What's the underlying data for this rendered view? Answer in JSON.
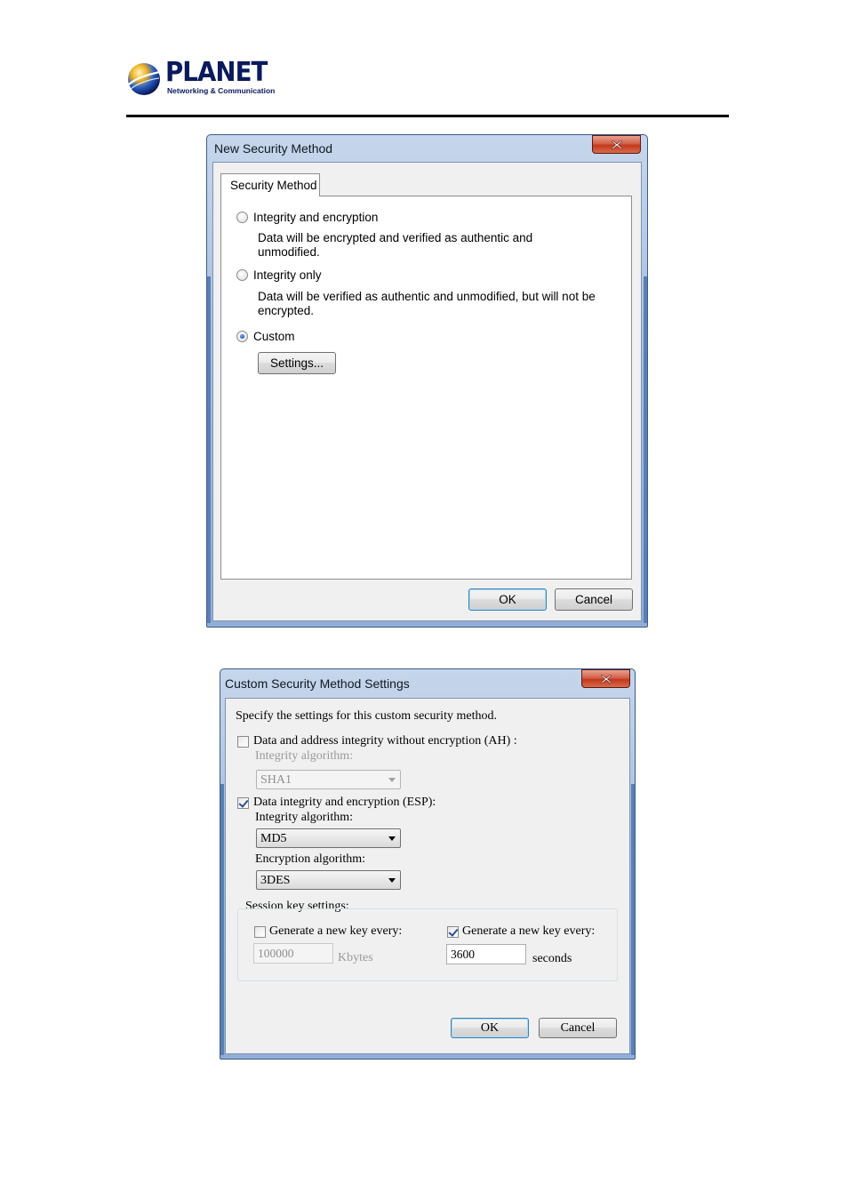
{
  "header": {
    "brand": "PLANET",
    "tagline": "Networking & Communication"
  },
  "dialog1": {
    "title": "New Security Method",
    "tab_label": "Security Method",
    "options": [
      {
        "label": "Integrity and encryption",
        "description": "Data will be encrypted and verified as authentic and unmodified.",
        "checked": false
      },
      {
        "label": "Integrity only",
        "description": "Data will be verified as authentic and unmodified, but will not be encrypted.",
        "checked": false
      },
      {
        "label": "Custom",
        "checked": true
      }
    ],
    "settings_button": "Settings...",
    "ok_button": "OK",
    "cancel_button": "Cancel"
  },
  "dialog2": {
    "title": "Custom Security Method Settings",
    "instruction": "Specify the settings for this custom security method.",
    "ah": {
      "label": "Data and address integrity without encryption (AH) :",
      "checked": false,
      "integrity_label": "Integrity algorithm:",
      "integrity_value": "SHA1"
    },
    "esp": {
      "label": "Data integrity and encryption (ESP):",
      "checked": true,
      "integrity_label": "Integrity algorithm:",
      "integrity_value": "MD5",
      "encryption_label": "Encryption algorithm:",
      "encryption_value": "3DES"
    },
    "session": {
      "group_label": "Session key settings:",
      "kbytes": {
        "label": "Generate a new key every:",
        "checked": false,
        "value": "100000",
        "unit": "Kbytes"
      },
      "seconds": {
        "label": "Generate a new key every:",
        "checked": true,
        "value": "3600",
        "unit": "seconds"
      }
    },
    "ok_button": "OK",
    "cancel_button": "Cancel"
  },
  "colors": {
    "title_bar": "#a9c0e0",
    "close_button": "#c2381d",
    "dialog_face": "#f0f0f0",
    "brand_blue": "#0a1a5c"
  }
}
